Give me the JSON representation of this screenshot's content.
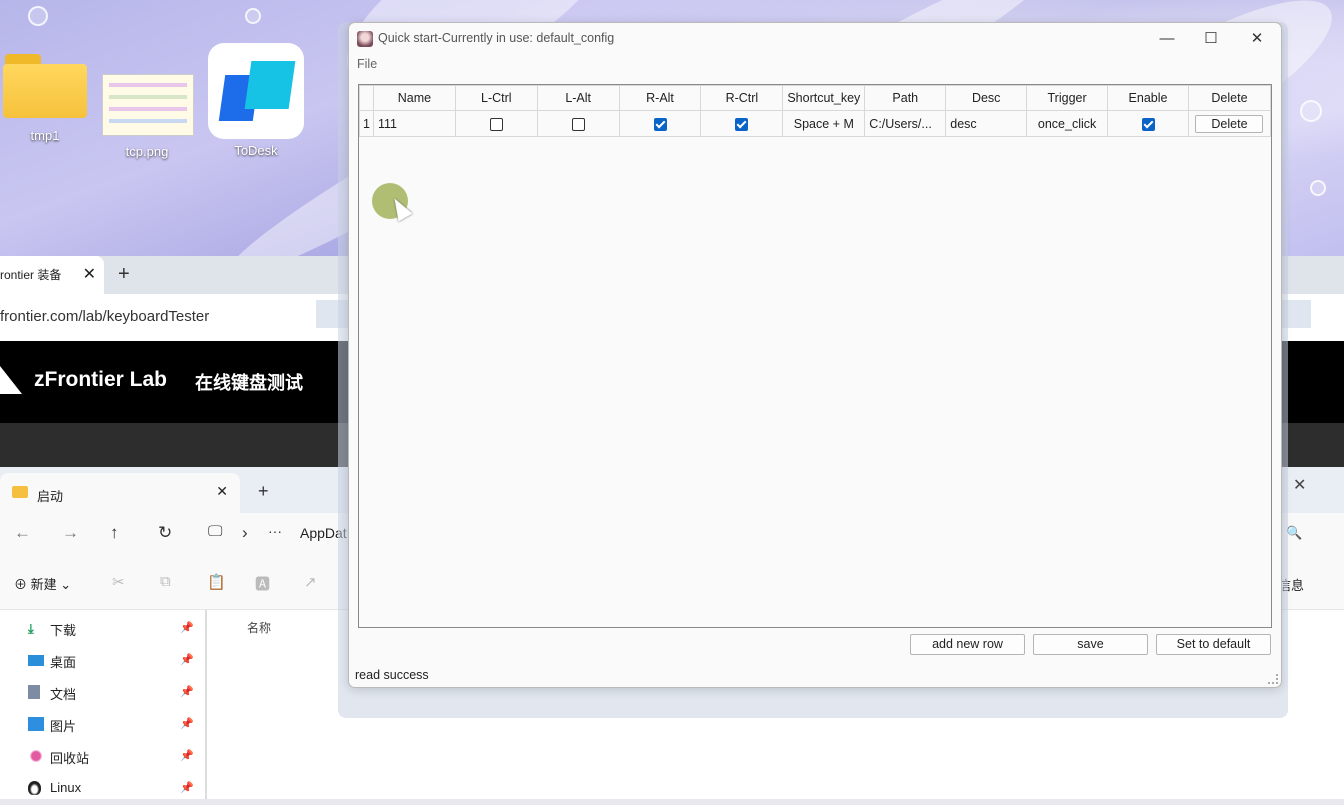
{
  "desktop": {
    "icons": [
      {
        "label": "tmp1"
      },
      {
        "label": "tcp.png"
      },
      {
        "label": "ToDesk"
      }
    ]
  },
  "browser": {
    "tab_title": "rontier 装备",
    "tab_close": "✕",
    "new_tab": "+",
    "url": "frontier.com/lab/keyboardTester",
    "site_brand": "zFrontier Lab",
    "site_subtitle": "在线键盘测试"
  },
  "explorer": {
    "tab_label": "启动",
    "tab_close": "✕",
    "new_tab": "+",
    "right_close": "✕",
    "nav": {
      "back": "←",
      "forward": "→",
      "up": "↑",
      "refresh": "↻",
      "monitor": "🖵",
      "chevron": "›",
      "more": "···",
      "path": "AppDat",
      "search": "🔍"
    },
    "toolbar": {
      "new_label": "⊕ 新建 ⌄",
      "info_label": "信息",
      "tools": [
        "✂",
        "⧉",
        "📋",
        "🅰",
        "↗",
        "🗑"
      ]
    },
    "sidebar": [
      {
        "label": "下载",
        "pin": "📌",
        "icon": "download-icon"
      },
      {
        "label": "桌面",
        "pin": "📌",
        "icon": "desktop-icon"
      },
      {
        "label": "文档",
        "pin": "📌",
        "icon": "document-icon"
      },
      {
        "label": "图片",
        "pin": "📌",
        "icon": "pictures-icon"
      },
      {
        "label": "回收站",
        "pin": "📌",
        "icon": "recycle-bin-icon"
      },
      {
        "label": "Linux",
        "pin": "📌",
        "icon": "linux-icon"
      }
    ],
    "column_name": "名称"
  },
  "app": {
    "title": "Quick start-Currently in use: default_config",
    "controls": {
      "minimize": "—",
      "maximize": "☐",
      "close": "✕"
    },
    "menu": {
      "file": "File"
    },
    "table": {
      "headers": [
        "Name",
        "L-Ctrl",
        "L-Alt",
        "R-Alt",
        "R-Ctrl",
        "Shortcut_key",
        "Path",
        "Desc",
        "Trigger",
        "Enable",
        "Delete"
      ],
      "rows": [
        {
          "index": "1",
          "name": "111",
          "l_ctrl": false,
          "l_alt": false,
          "r_alt": true,
          "r_ctrl": true,
          "shortcut_key": "Space + M",
          "path": "C:/Users/...",
          "desc": "desc",
          "trigger": "once_click",
          "enable": true,
          "delete_label": "Delete"
        }
      ]
    },
    "buttons": {
      "add_row": "add new row",
      "save": "save",
      "set_default": "Set to default"
    },
    "status": "read success",
    "colors": {
      "accent": "#0a64c8",
      "window_bg": "#fafafa"
    }
  }
}
